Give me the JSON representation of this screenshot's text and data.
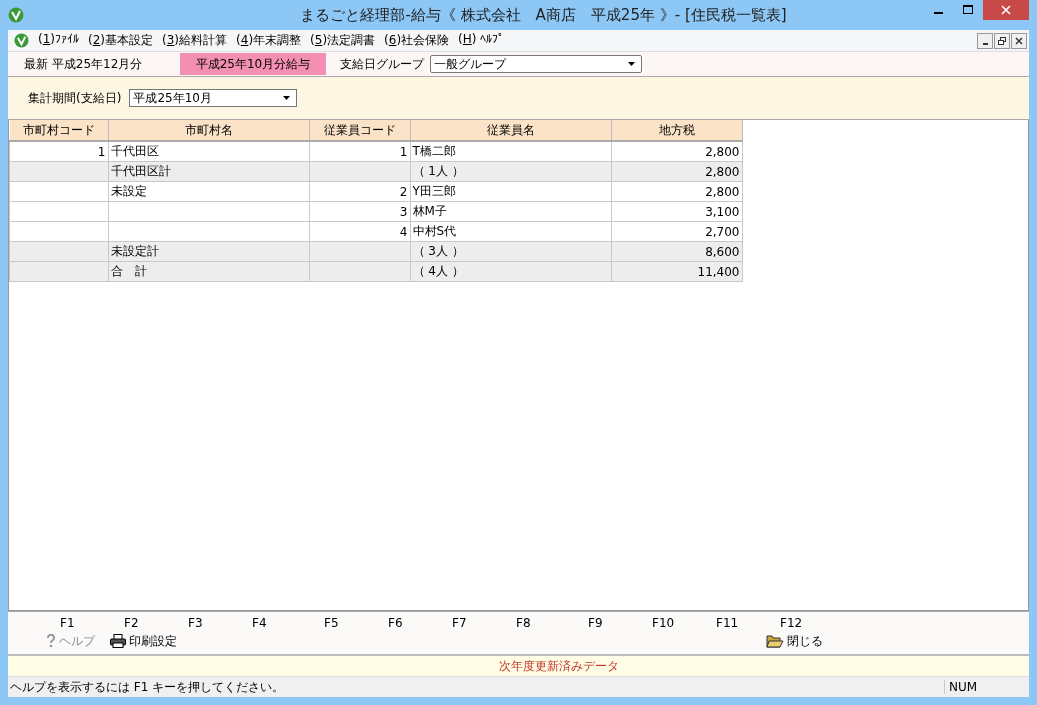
{
  "window": {
    "title": "まるごと経理部-給与《 株式会社　A商店　平成25年 》- [住民税一覧表]"
  },
  "menu": [
    {
      "pre": "(",
      "key": "1",
      "post": ")ﾌｧｲﾙ"
    },
    {
      "pre": "(",
      "key": "2",
      "post": ")基本設定"
    },
    {
      "pre": "(",
      "key": "3",
      "post": ")給料計算"
    },
    {
      "pre": "(",
      "key": "4",
      "post": ")年末調整"
    },
    {
      "pre": "(",
      "key": "5",
      "post": ")法定調書"
    },
    {
      "pre": "(",
      "key": "6",
      "post": ")社会保険"
    },
    {
      "pre": "(",
      "key": "H",
      "post": ") ﾍﾙﾌﾟ"
    }
  ],
  "info": {
    "latest": "最新 平成25年12月分",
    "current": "平成25年10月分給与",
    "group_label": "支給日グループ",
    "group_value": "一般グループ"
  },
  "filter": {
    "label": "集計期間(支給日)",
    "value": "平成25年10月"
  },
  "table": {
    "columns": [
      "市町村コード",
      "市町村名",
      "従業員コード",
      "従業員名",
      "地方税"
    ],
    "rows": [
      {
        "kind": "detail",
        "cells": [
          "1",
          "千代田区",
          "1",
          "T橋二郎",
          "2,800"
        ]
      },
      {
        "kind": "subtotal",
        "cells": [
          "",
          "千代田区計",
          "",
          "（ 1人 ）",
          "2,800"
        ]
      },
      {
        "kind": "detail",
        "cells": [
          "",
          "未設定",
          "2",
          "Y田三郎",
          "2,800"
        ]
      },
      {
        "kind": "detail",
        "cells": [
          "",
          "",
          "3",
          "林M子",
          "3,100"
        ]
      },
      {
        "kind": "detail",
        "cells": [
          "",
          "",
          "4",
          "中村S代",
          "2,700"
        ]
      },
      {
        "kind": "subtotal",
        "cells": [
          "",
          "未設定計",
          "",
          "（ 3人 ）",
          "8,600"
        ]
      },
      {
        "kind": "subtotal",
        "cells": [
          "",
          "合　計",
          "",
          "（ 4人 ）",
          "11,400"
        ]
      }
    ]
  },
  "function_keys": [
    {
      "key": "F1",
      "button": {
        "label": "ヘルプ",
        "kind": "help",
        "disabled": true
      }
    },
    {
      "key": "F2",
      "button": {
        "label": "印刷設定",
        "kind": "print",
        "disabled": false
      }
    },
    {
      "key": "F3"
    },
    {
      "key": "F4"
    },
    {
      "key": "F5"
    },
    {
      "key": "F6"
    },
    {
      "key": "F7"
    },
    {
      "key": "F8"
    },
    {
      "key": "F9"
    },
    {
      "key": "F10"
    },
    {
      "key": "F11"
    },
    {
      "key": "F12",
      "button": {
        "label": "閉じる",
        "kind": "close",
        "disabled": false
      }
    }
  ],
  "notice": "次年度更新済みデータ",
  "status_bar": {
    "message": "ヘルプを表示するには F1 キーを押してください。",
    "num": "NUM"
  }
}
